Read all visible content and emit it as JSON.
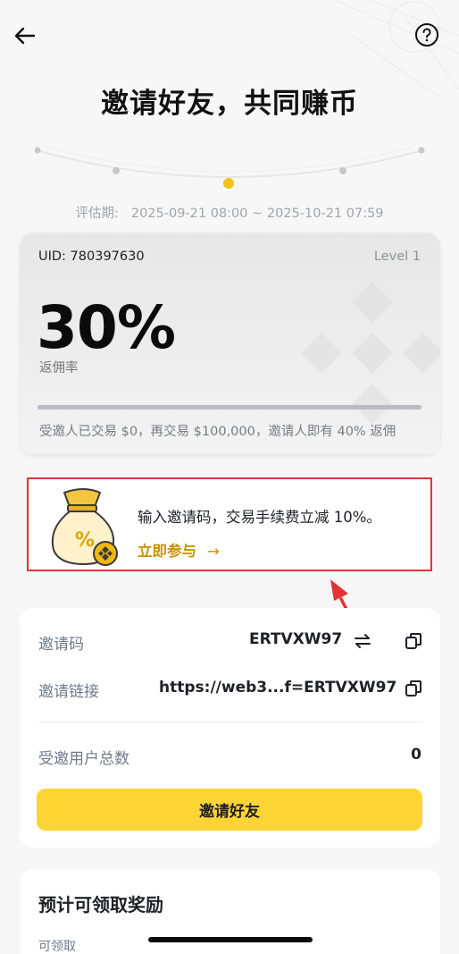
{
  "header": {
    "back_icon": "arrow-left-icon",
    "help_icon": "question-circle-icon",
    "title": "邀请好友，共同赚币"
  },
  "period": {
    "label": "评估期:",
    "range": "2025-09-21 08:00 ~ 2025-10-21 07:59"
  },
  "tier_card": {
    "uid": "UID: 780397630",
    "level": "Level 1",
    "rate": "30%",
    "rate_label": "返佣率",
    "progress": 0.0,
    "hint": "受邀人已交易 $0，再交易 $100,000，邀请人即有 40% 返佣"
  },
  "promo": {
    "text": "输入邀请码，交易手续费立减 10%。",
    "join_label": "立即参与",
    "join_arrow": "→",
    "highlight_color": "#e23434",
    "accent_color": "#c99400"
  },
  "invite_panel": {
    "code_label": "邀请码",
    "code_value": "ERTVXW97",
    "swap_icon": "swap-icon",
    "copy_icon": "copy-icon",
    "link_label": "邀请链接",
    "link_value": "https://web3...f=ERTVXW97",
    "total_label": "受邀用户总数",
    "total_value": "0",
    "invite_button": "邀请好友",
    "button_color": "#fcd535"
  },
  "rewards_panel": {
    "title": "预计可领取奖励",
    "sub_label": "可领取"
  }
}
